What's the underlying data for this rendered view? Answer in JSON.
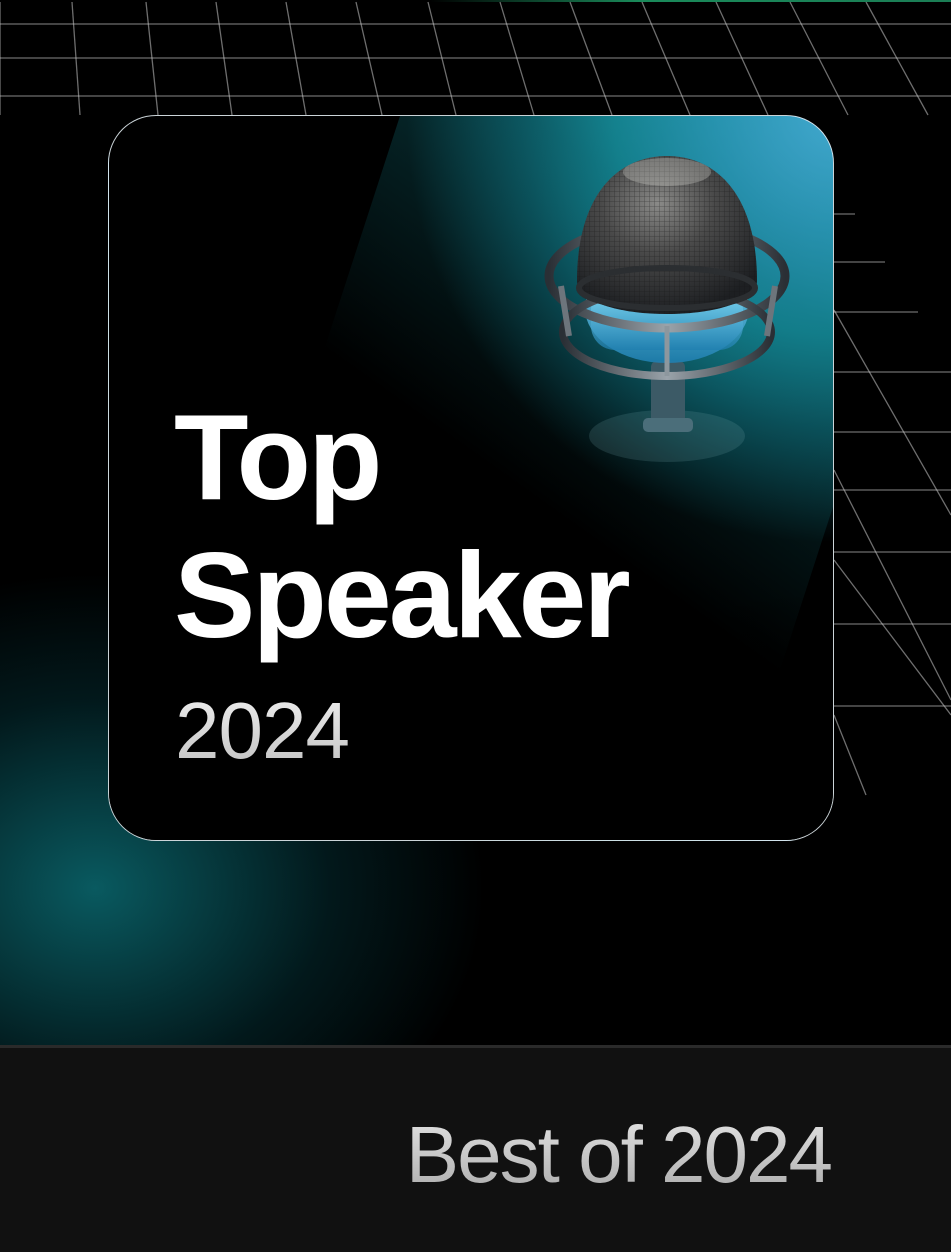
{
  "badge": {
    "title_lines": [
      "Top",
      "Speaker"
    ],
    "year": "2024",
    "icon": "microphone-icon"
  },
  "footer": {
    "label": "Best of 2024"
  },
  "colors": {
    "background": "#000000",
    "accent_teal": "#117a88",
    "accent_blue": "#5aa8e6",
    "card_border": "#e1ebf0",
    "footer_bg": "#111111",
    "text_primary": "#ffffff",
    "text_secondary": "#cfcfcf"
  }
}
